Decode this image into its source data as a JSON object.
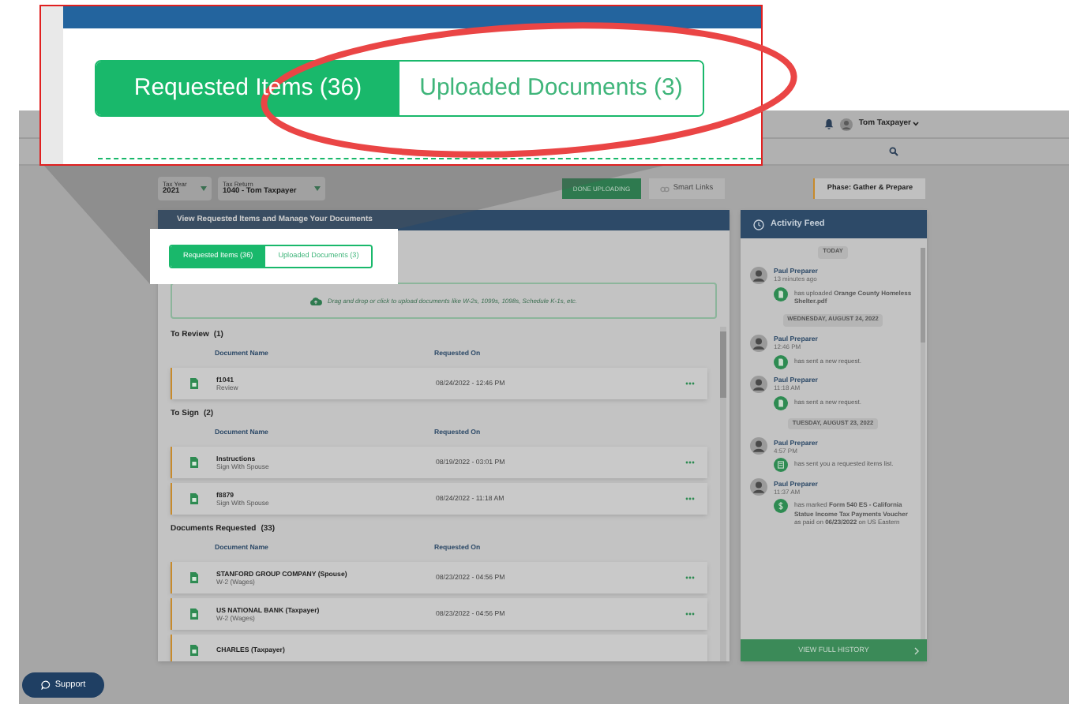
{
  "callout": {
    "tabs": [
      {
        "label": "Requested Items (36)",
        "selected": true
      },
      {
        "label": "Uploaded Documents (3)",
        "selected": false
      }
    ]
  },
  "header": {
    "user": "Tom Taxpayer"
  },
  "toolbar": {
    "tax_year": {
      "label": "Tax Year",
      "value": "2021"
    },
    "tax_return": {
      "label": "Tax Return",
      "value": "1040 - Tom Taxpayer"
    },
    "done_button": "DONE UPLOADING",
    "links_button": "Smart Links",
    "phase": "Phase: Gather & Prepare"
  },
  "documents_panel": {
    "title": "View Requested Items and Manage Your Documents",
    "tabs": [
      {
        "label": "Requested Items (36)",
        "selected": true
      },
      {
        "label": "Uploaded Documents (3)",
        "selected": false
      }
    ],
    "dropzone": "Drag and drop or click to upload documents like W-2s, 1099s, 1098s, Schedule K-1s, etc.",
    "sections": [
      {
        "title": "To Review",
        "count": "(1)",
        "columns": [
          "Document Name",
          "Requested On"
        ],
        "rows": [
          {
            "name": "f1041",
            "subtitle": "Review",
            "requested_on": "08/24/2022 - 12:46 PM"
          }
        ]
      },
      {
        "title": "To Sign",
        "count": "(2)",
        "columns": [
          "Document Name",
          "Requested On"
        ],
        "rows": [
          {
            "name": "Instructions",
            "subtitle": "Sign With Spouse",
            "requested_on": "08/19/2022 - 03:01 PM"
          },
          {
            "name": "f8879",
            "subtitle": "Sign With Spouse",
            "requested_on": "08/24/2022 - 11:18 AM"
          }
        ]
      },
      {
        "title": "Documents Requested",
        "count": "(33)",
        "columns": [
          "Document Name",
          "Requested On"
        ],
        "rows": [
          {
            "name": "STANFORD GROUP COMPANY (Spouse)",
            "subtitle": "W-2 (Wages)",
            "requested_on": "08/23/2022 - 04:56 PM"
          },
          {
            "name": "US NATIONAL BANK (Taxpayer)",
            "subtitle": "W-2 (Wages)",
            "requested_on": "08/23/2022 - 04:56 PM"
          },
          {
            "name": "CHARLES (Taxpayer)"
          }
        ]
      }
    ]
  },
  "activity_feed": {
    "title": "Activity Feed",
    "entries": [
      {
        "kind": "date",
        "label": "TODAY"
      },
      {
        "kind": "upload",
        "author": "Paul Preparer",
        "time": "13 minutes ago",
        "message": "has uploaded **Orange County Homeless Shelter.pdf**"
      },
      {
        "kind": "date",
        "label": "WEDNESDAY, AUGUST 24, 2022"
      },
      {
        "kind": "request",
        "author": "Paul Preparer",
        "time": "12:46 PM",
        "message": "has sent a new request."
      },
      {
        "kind": "request",
        "author": "Paul Preparer",
        "time": "11:18 AM",
        "message": "has sent a new request."
      },
      {
        "kind": "date",
        "label": "TUESDAY, AUGUST 23, 2022"
      },
      {
        "kind": "list",
        "author": "Paul Preparer",
        "time": "4:57 PM",
        "message": "has sent you a requested items list."
      },
      {
        "kind": "payment",
        "author": "Paul Preparer",
        "time": "11:37 AM",
        "message": "has marked **Form 540 ES - California Statue Income Tax Payments Voucher** as paid on **06/23/2022** on US Eastern"
      }
    ],
    "footer": "VIEW FULL HISTORY"
  },
  "support": "Support"
}
